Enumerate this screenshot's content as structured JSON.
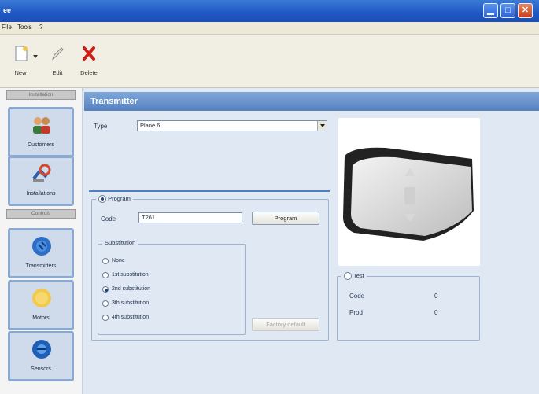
{
  "window": {
    "title": "ee"
  },
  "menu": [
    "File",
    "Tools",
    "?"
  ],
  "toolbar": {
    "new_label": "New",
    "edit_label": "Edit",
    "delete_label": "Delete"
  },
  "nav": {
    "header1": "Installation",
    "header2": "Controls",
    "items": [
      {
        "label": "Customers",
        "icon": "customers-icon"
      },
      {
        "label": "Installations",
        "icon": "installations-icon"
      },
      {
        "label": "Transmitters",
        "icon": "transmitters-icon"
      },
      {
        "label": "Motors",
        "icon": "motors-icon"
      },
      {
        "label": "Sensors",
        "icon": "sensors-icon"
      }
    ]
  },
  "page": {
    "title": "Transmitter"
  },
  "type": {
    "label": "Type",
    "value": "Plane 6"
  },
  "program": {
    "legend": "Program",
    "code_label": "Code",
    "code_value": "T261",
    "program_button": "Program",
    "substitution_legend": "Substitution",
    "options": [
      "None",
      "1st substitution",
      "2nd substitution",
      "3th substitution",
      "4th substitution"
    ],
    "selected_index": 2,
    "disabled_button": "Factory default"
  },
  "test": {
    "legend": "Test",
    "code_label": "Code",
    "code_value": "0",
    "prod_label": "Prod",
    "prod_value": "0"
  },
  "colors": {
    "titlebar": "#1f57c2",
    "header": "#5681bf",
    "accent": "#3b79d6"
  }
}
